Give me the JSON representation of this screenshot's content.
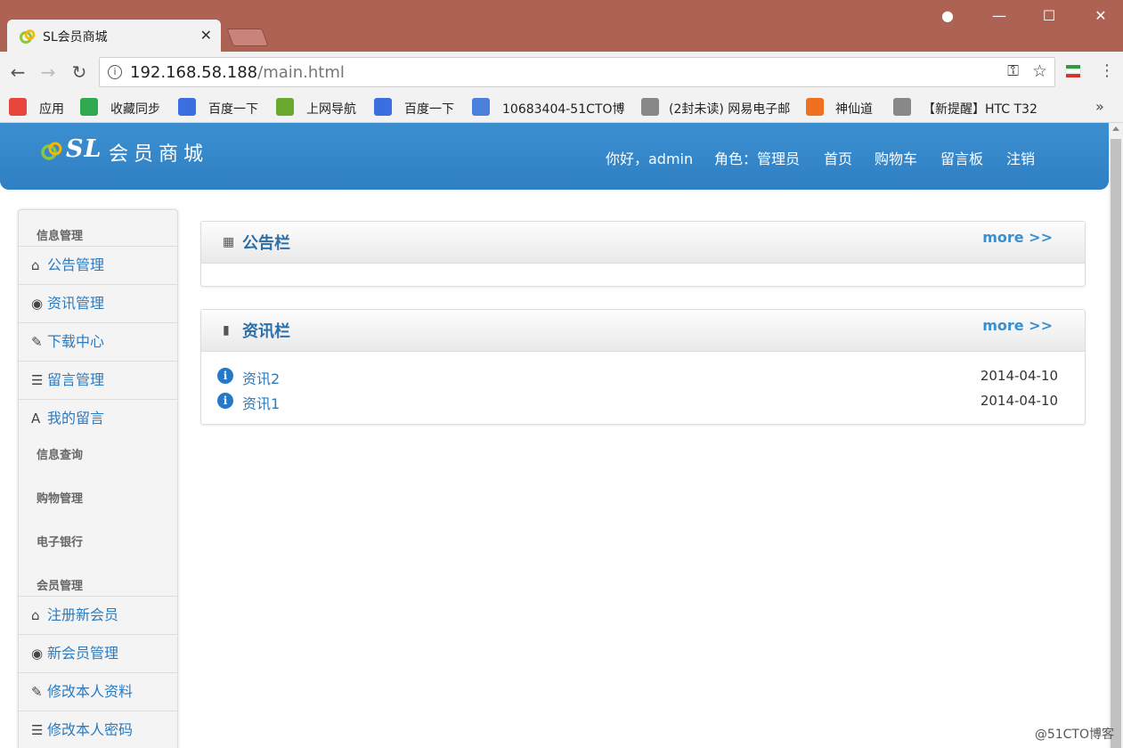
{
  "browser": {
    "tab_title": "SL会员商城",
    "tab_close": "✕",
    "window_controls": {
      "minimize": "—",
      "maximize": "☐",
      "close": "✕",
      "account": "●"
    },
    "nav": {
      "back": "←",
      "forward": "→",
      "reload": "↻"
    },
    "url_host": "192.168.58.188",
    "url_path": "/main.html",
    "bookmarks": [
      {
        "label": "应用",
        "icon": "apps-grid-icon",
        "color": "#e8453c"
      },
      {
        "label": "收藏同步",
        "icon": "ie-icon",
        "color": "#2fa84f"
      },
      {
        "label": "百度一下",
        "icon": "baidu-paw-icon",
        "color": "#3b6fe0"
      },
      {
        "label": "上网导航",
        "icon": "hao-icon",
        "color": "#6aa82f"
      },
      {
        "label": "百度一下",
        "icon": "baidu-paw-icon",
        "color": "#3b6fe0"
      },
      {
        "label": "10683404-51CTO博",
        "icon": "feather-icon",
        "color": "#4a7fdc"
      },
      {
        "label": "(2封未读) 网易电子邮",
        "icon": "page-icon",
        "color": "#888888"
      },
      {
        "label": "神仙道",
        "icon": "game-icon",
        "color": "#f07020"
      },
      {
        "label": "【新提醒】HTC T32",
        "icon": "page-icon",
        "color": "#888888"
      }
    ],
    "bookmarks_more": "»"
  },
  "header": {
    "logo_sl": "SL",
    "logo_name": "会员商城",
    "greeting": "你好，admin",
    "role": "角色：管理员",
    "nav": [
      "首页",
      "购物车",
      "留言板",
      "注销"
    ]
  },
  "sidebar": {
    "sections": [
      {
        "title": "信息管理",
        "items": [
          {
            "label": "公告管理",
            "icon": "home-icon",
            "glyph": "⌂"
          },
          {
            "label": "资讯管理",
            "icon": "eye-icon",
            "glyph": "◉"
          },
          {
            "label": "下载中心",
            "icon": "edit-icon",
            "glyph": "✎"
          },
          {
            "label": "留言管理",
            "icon": "list-icon",
            "glyph": "☰"
          },
          {
            "label": "我的留言",
            "icon": "font-icon",
            "glyph": "A"
          }
        ]
      },
      {
        "title": "信息查询",
        "items": []
      },
      {
        "title": "购物管理",
        "items": []
      },
      {
        "title": "电子银行",
        "items": []
      },
      {
        "title": "会员管理",
        "items": [
          {
            "label": "注册新会员",
            "icon": "home-icon",
            "glyph": "⌂"
          },
          {
            "label": "新会员管理",
            "icon": "eye-icon",
            "glyph": "◉"
          },
          {
            "label": "修改本人资料",
            "icon": "edit-icon",
            "glyph": "✎"
          },
          {
            "label": "修改本人密码",
            "icon": "list-icon",
            "glyph": "☰"
          }
        ]
      }
    ]
  },
  "notice_panel": {
    "title": "公告栏",
    "more": "more >>",
    "icon": "grid-icon"
  },
  "news_panel": {
    "title": "资讯栏",
    "more": "more >>",
    "icon": "file-icon",
    "items": [
      {
        "title": "资讯2",
        "date": "2014-04-10"
      },
      {
        "title": "资讯1",
        "date": "2014-04-10"
      }
    ]
  },
  "watermark": "@51CTO博客",
  "colors": {
    "header": "#3b8fcf",
    "link": "#2b7bc0",
    "titlebar": "#ad6254"
  }
}
